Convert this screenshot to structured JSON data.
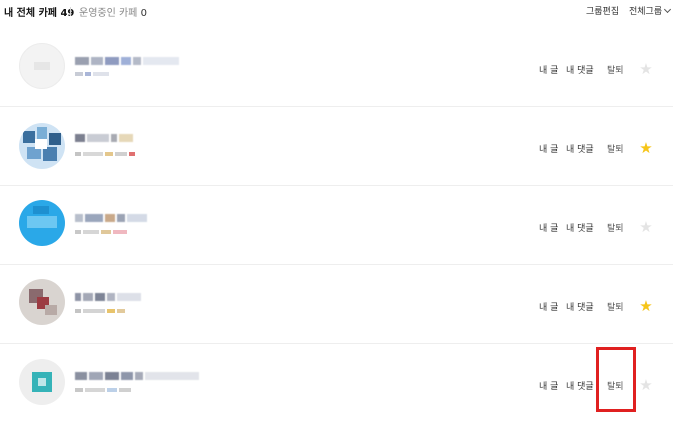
{
  "header": {
    "title": "내 전체 카페 49",
    "managed_label": "운영중인 카페",
    "managed_count": "0",
    "edit_groups": "그룹편집",
    "all_groups": "전체그룹"
  },
  "rows": [
    {
      "my_posts": "내 글",
      "my_comments": "내 댓글",
      "leave": "탈퇴",
      "favorite": false
    },
    {
      "my_posts": "내 글",
      "my_comments": "내 댓글",
      "leave": "탈퇴",
      "favorite": true
    },
    {
      "my_posts": "내 글",
      "my_comments": "내 댓글",
      "leave": "탈퇴",
      "favorite": false
    },
    {
      "my_posts": "내 글",
      "my_comments": "내 댓글",
      "leave": "탈퇴",
      "favorite": true
    },
    {
      "my_posts": "내 글",
      "my_comments": "내 댓글",
      "leave": "탈퇴",
      "favorite": false
    }
  ],
  "icons": {
    "star": "star-icon",
    "chevron": "chevron-down-icon"
  },
  "colors": {
    "star_on": "#f6c519",
    "star_off": "#e4e4e4",
    "highlight": "#e02020"
  }
}
